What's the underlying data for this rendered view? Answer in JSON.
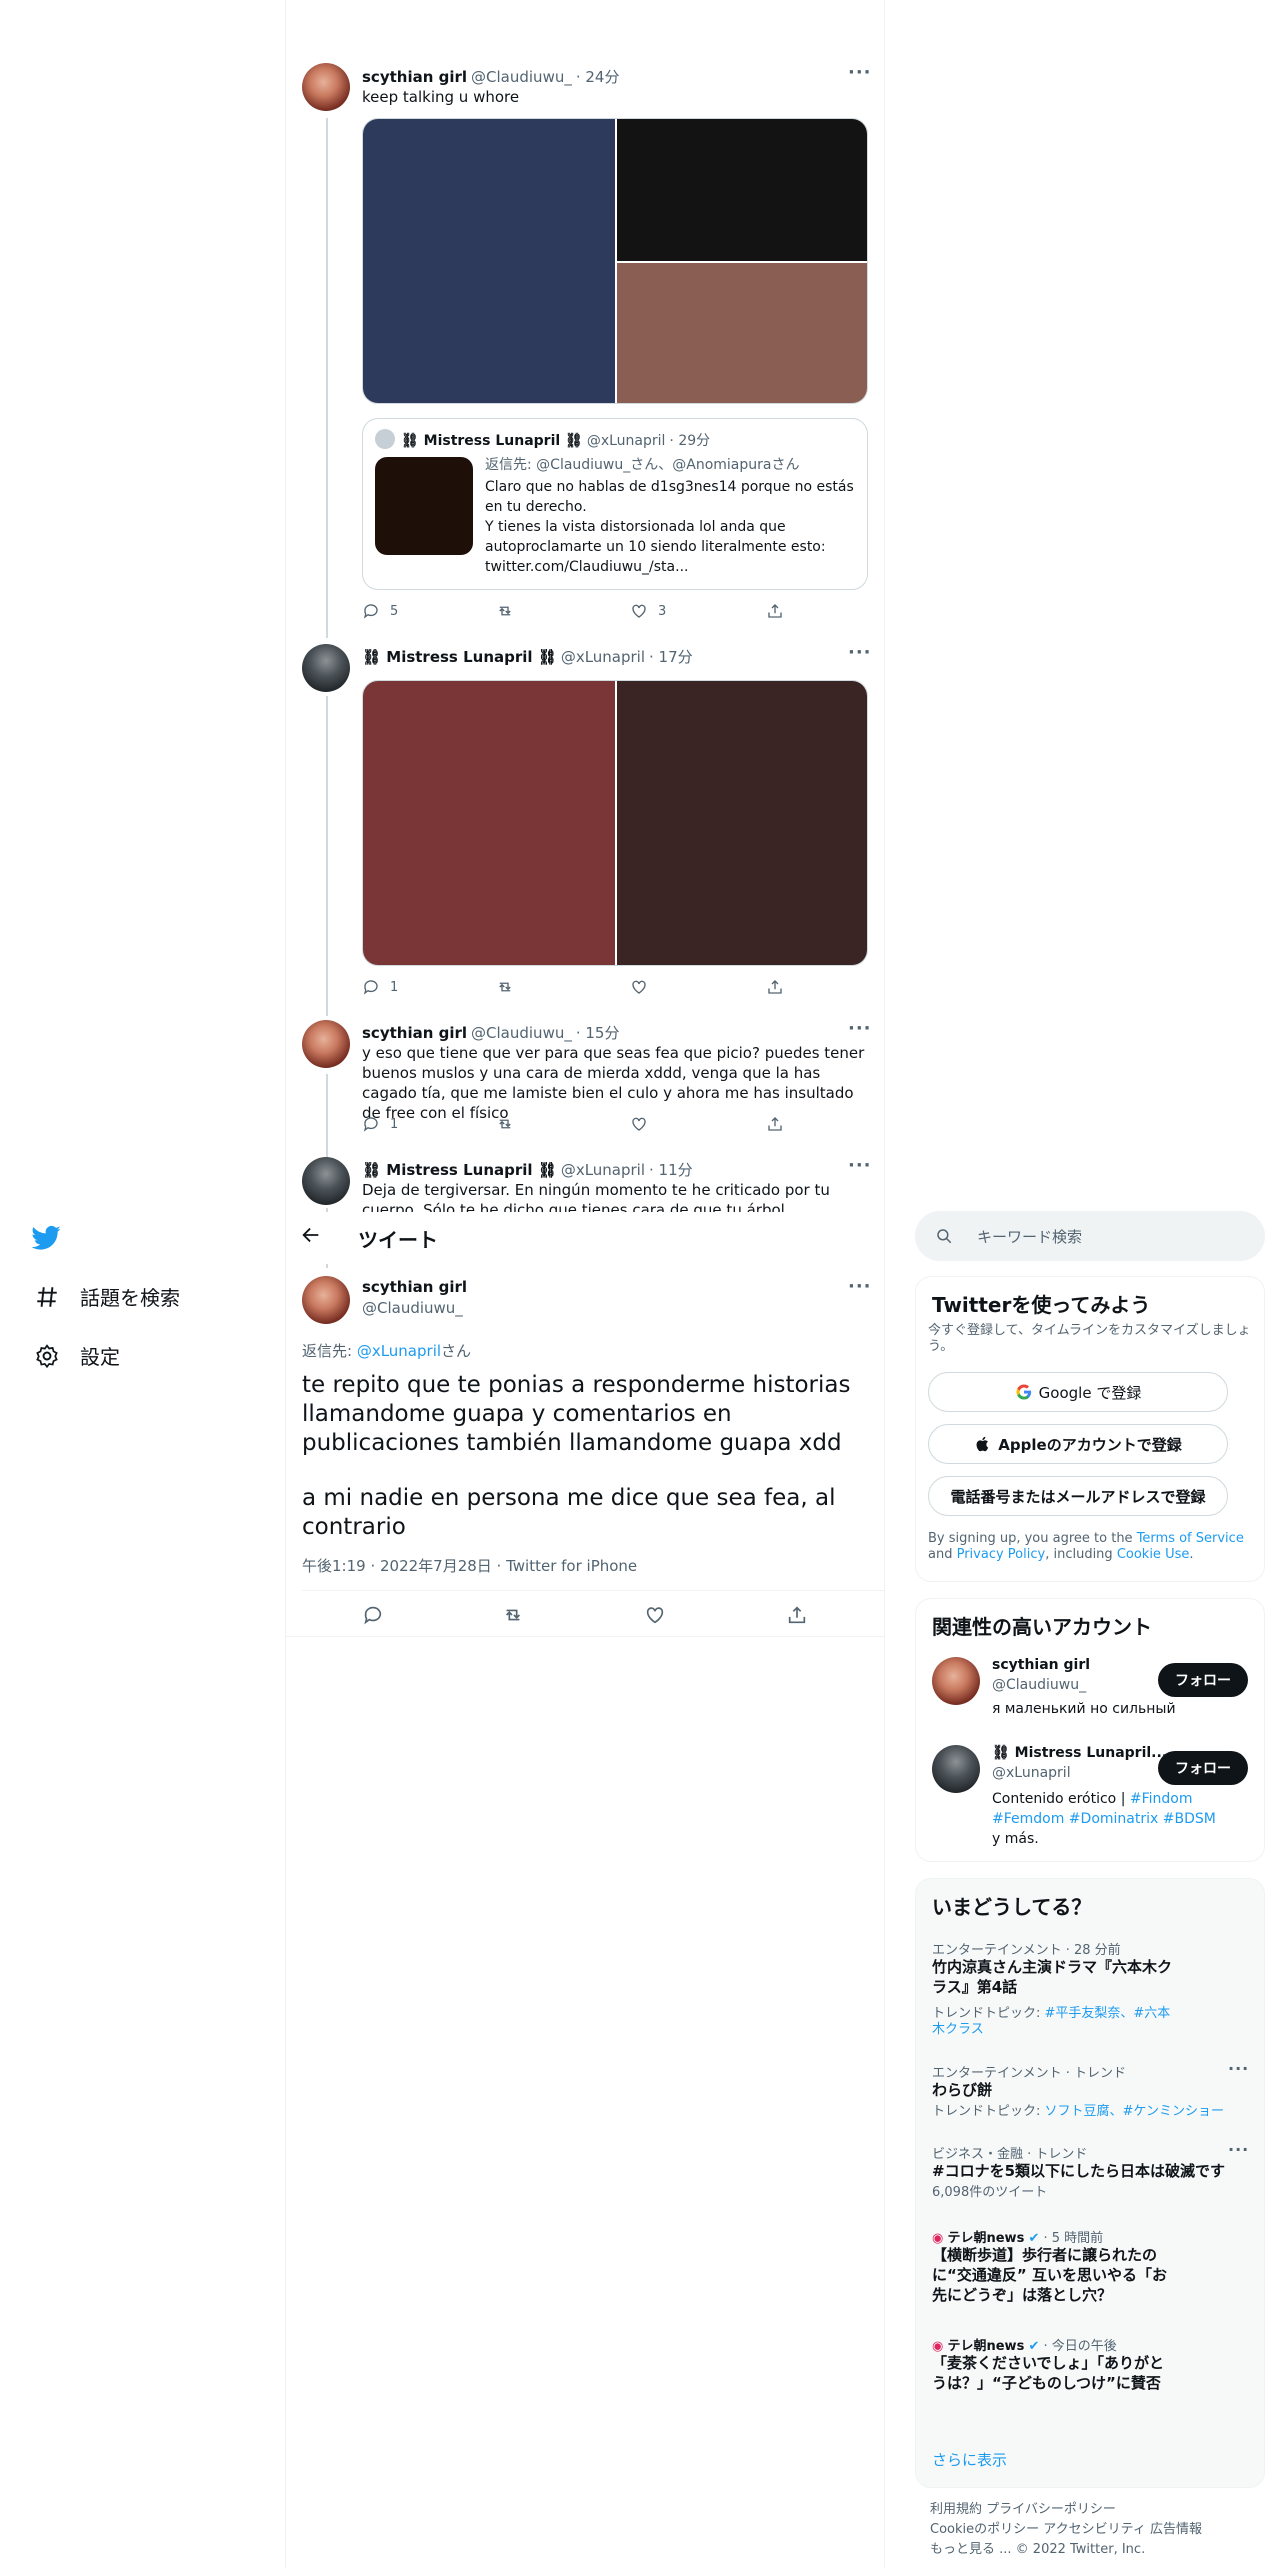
{
  "colors": {
    "accent": "#1d9bf0",
    "text": "#0f1419",
    "muted": "#536471",
    "border": "#cfd9de"
  },
  "thread": {
    "tweet1": {
      "name": "scythian girl",
      "handle": "@Claudiuwu_",
      "time": "· 24分",
      "text": "keep talking u whore",
      "media_colors": [
        "#2d3a5c",
        "#131313",
        "#8a5e52"
      ],
      "quote": {
        "name": "⛓ Mistress Lunapril ⛓",
        "handle": "@xLunapril",
        "time": "· 29分",
        "reply_to": "返信先: @Claudiuwu_さん、@Anomiapuraさん",
        "text": "Claro que no hablas de d1sg3nes14 porque no estás en tu derecho.\nY tienes la vista distorsionada lol anda que autoproclamarte un 10 siendo literalmente esto: twitter.com/Claudiuwu_/sta..."
      },
      "replies": "5",
      "retweets": "",
      "likes": "3"
    },
    "tweet2": {
      "name": "⛓ Mistress Lunapril ⛓",
      "handle": "@xLunapril",
      "time": "· 17分",
      "media_colors": [
        "#7a3536",
        "#3a2424"
      ],
      "replies": "1",
      "retweets": "",
      "likes": ""
    },
    "tweet3": {
      "name": "scythian girl",
      "handle": "@Claudiuwu_",
      "time": "· 15分",
      "text": "y eso que tiene que ver para que seas fea que picio? puedes tener buenos muslos y una cara de mierda xddd, venga que la has cagado tía, que me lamiste bien el culo y ahora me has insultado de free con el físico",
      "replies": "1",
      "retweets": "",
      "likes": ""
    },
    "tweet4": {
      "name": "⛓ Mistress Lunapril ⛓",
      "handle": "@xLunapril",
      "time": "· 11分",
      "text": "Deja de tergiversar. En ningún momento te he criticado por tu cuerpo. Sólo te he dicho que tienes cara de que tu árbol genealógico sea un círculo"
    }
  },
  "sidebar": {
    "items": [
      {
        "label": "話題を検索",
        "icon": "hashtag-icon"
      },
      {
        "label": "設定",
        "icon": "gear-icon"
      }
    ]
  },
  "header": {
    "title": "ツイート"
  },
  "main_tweet": {
    "name": "scythian girl",
    "handle": "@Claudiuwu_",
    "reply_prefix": "返信先: ",
    "reply_handle": "@xLunapril",
    "reply_suffix": "さん",
    "text1": "te repito que te ponias a responderme historias llamandome guapa y comentarios en publicaciones también llamandome guapa xdd",
    "text2": "a mi nadie en persona me dice que sea fea, al contrario",
    "meta": "午後1:19 · 2022年7月28日 · Twitter for iPhone"
  },
  "search": {
    "placeholder": "キーワード検索"
  },
  "signup": {
    "title": "Twitterを使ってみよう",
    "subtitle": "今すぐ登録して、タイムラインをカスタマイズしましょう。",
    "google": "Google で登録",
    "apple": "Appleのアカウントで登録",
    "phone": "電話番号またはメールアドレスで登録",
    "terms_a": "By signing up, you agree to the ",
    "terms_link1": "Terms of Service",
    "terms_b": " and ",
    "terms_link2": "Privacy Policy",
    "terms_c": ", including ",
    "terms_link3": "Cookie Use",
    "terms_d": "."
  },
  "relevant": {
    "title": "関連性の高いアカウント",
    "follow": "フォロー",
    "accounts": [
      {
        "name": "scythian girl",
        "handle": "@Claudiuwu_",
        "bio": "я маленький но сильный"
      },
      {
        "name": "⛓ Mistress Lunapril...",
        "handle": "@xLunapril",
        "bio_a": "Contenido erótico | ",
        "bio_tags": "#Findom #Femdom #Dominatrix #BDSM",
        "bio_b": " y más."
      }
    ]
  },
  "trends": {
    "title": "いまどうしてる？",
    "items": [
      {
        "cat": "エンターテインメント · 28 分前",
        "title": "竹内涼真さん主演ドラマ『六本木クラス』第4話",
        "sub_a": "トレンドトピック: ",
        "sub_link": "#平手友梨奈、#六本木クラス"
      },
      {
        "cat": "エンターテインメント · トレンド",
        "title": "わらび餅",
        "sub_a": "トレンドトピック: ",
        "sub_link": "ソフト豆腐、#ケンミンショー"
      },
      {
        "cat": "ビジネス・金融 · トレンド",
        "title": "#コロナを5類以下にしたら日本は破滅です",
        "sub_a": "6,098件のツイート",
        "sub_link": ""
      },
      {
        "cat_src": "テレ朝news",
        "cat_time": " · 5 時間前",
        "title": "【横断歩道】歩行者に譲られたのに“交通違反” 互いを思いやる「お先にどうぞ」は落とし穴？"
      },
      {
        "cat_src": "テレ朝news",
        "cat_time": " · 今日の午後",
        "title": "「麦茶くださいでしょ」「ありがとうは？」“子どものしつけ”に賛否"
      }
    ],
    "more": "さらに表示"
  },
  "footer": {
    "line1": "利用規約   プライバシーポリシー",
    "line2": "Cookieのポリシー   アクセシビリティ   広告情報",
    "line3": "もっと見る ...   © 2022 Twitter, Inc."
  }
}
